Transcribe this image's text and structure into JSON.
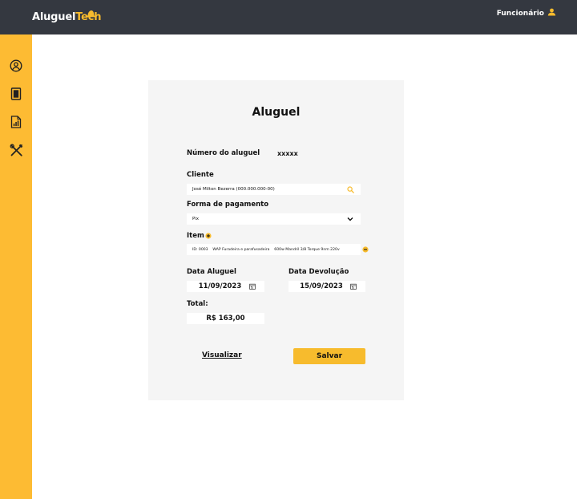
{
  "header": {
    "logo_part1": "Aluguel",
    "logo_part2": "Tech",
    "user_label": "Funcionário"
  },
  "sidebar": {
    "items": [
      {
        "icon": "user-circle-icon"
      },
      {
        "icon": "document-icon"
      },
      {
        "icon": "report-chart-icon"
      },
      {
        "icon": "tools-icon"
      }
    ]
  },
  "form": {
    "title": "Aluguel",
    "rental_number_label": "Número do aluguel",
    "rental_number_value": "xxxxx",
    "client_label": "Cliente",
    "client_value": "José Milton Bezerra (000.000.000-00)",
    "payment_label": "Forma de pagamento",
    "payment_value": "Pix",
    "item_label": "Item",
    "item_value": "ID: 0003    WAP Furadeira e parafusadeira    600w Mandril 3/8 Torque 9nm 220v",
    "rental_date_label": "Data Aluguel",
    "rental_date_value": "11/09/2023",
    "return_date_label": "Data Devolução",
    "return_date_value": "15/09/2023",
    "total_label": "Total:",
    "total_value": "R$ 163,00",
    "view_label": "Visualizar",
    "save_label": "Salvar"
  },
  "colors": {
    "accent": "#f7bb2d",
    "topbar": "#343840",
    "sidebar": "#fdbb33",
    "card": "#f5f5f5"
  }
}
